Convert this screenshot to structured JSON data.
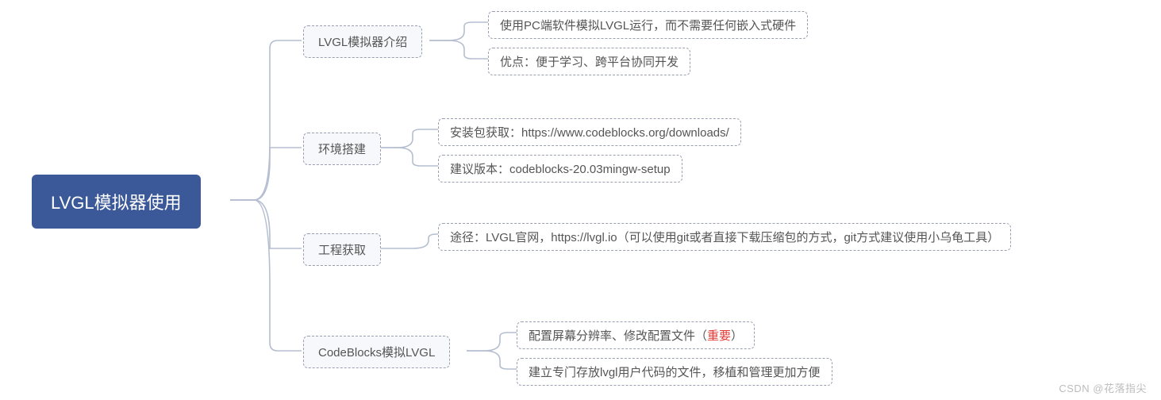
{
  "root": {
    "title": "LVGL模拟器使用"
  },
  "branches": {
    "intro": {
      "label": "LVGL模拟器介绍",
      "leaf1": "使用PC端软件模拟LVGL运行，而不需要任何嵌入式硬件",
      "leaf2": "优点：便于学习、跨平台协同开发"
    },
    "env": {
      "label": "环境搭建",
      "leaf1": "安装包获取：https://www.codeblocks.org/downloads/",
      "leaf2": "建议版本：codeblocks-20.03mingw-setup"
    },
    "proj": {
      "label": "工程获取",
      "leaf1": "途径：LVGL官网，https://lvgl.io（可以使用git或者直接下载压缩包的方式，git方式建议使用小乌龟工具）"
    },
    "cb": {
      "label": "CodeBlocks模拟LVGL",
      "leaf1_prefix": "配置屏幕分辨率、修改配置文件（",
      "leaf1_em": "重要",
      "leaf1_suffix": "）",
      "leaf2": "建立专门存放lvgl用户代码的文件，移植和管理更加方便"
    }
  },
  "watermark": "CSDN @花落指尖"
}
